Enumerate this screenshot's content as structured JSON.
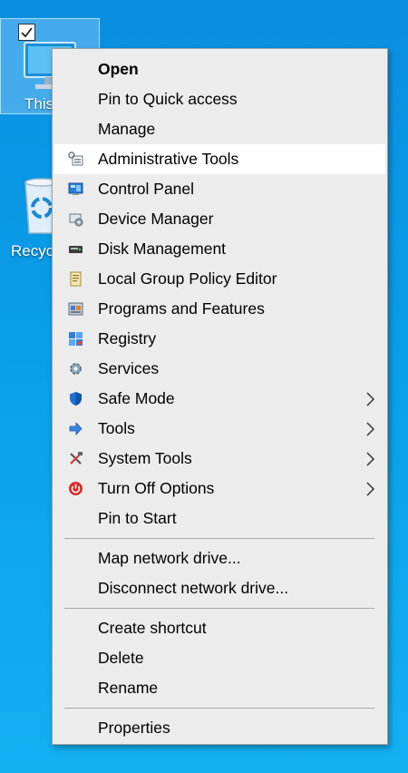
{
  "desktop": {
    "this_pc_label": "This PC",
    "recycle_bin_label": "Recycle Bin",
    "accent_color": "#0a9ee8"
  },
  "menu": {
    "group1": [
      {
        "label": "Open",
        "bold": true
      },
      {
        "label": "Pin to Quick access"
      },
      {
        "label": "Manage"
      },
      {
        "label": "Administrative Tools",
        "icon": "admin-tools-icon",
        "hover": true
      },
      {
        "label": "Control Panel",
        "icon": "control-panel-icon"
      },
      {
        "label": "Device Manager",
        "icon": "device-manager-icon"
      },
      {
        "label": "Disk Management",
        "icon": "disk-management-icon"
      },
      {
        "label": "Local Group Policy Editor",
        "icon": "group-policy-icon"
      },
      {
        "label": "Programs and Features",
        "icon": "programs-features-icon"
      },
      {
        "label": "Registry",
        "icon": "registry-icon"
      },
      {
        "label": "Services",
        "icon": "services-icon"
      },
      {
        "label": "Safe Mode",
        "icon": "shield-icon",
        "submenu": true
      },
      {
        "label": "Tools",
        "icon": "arrow-icon",
        "submenu": true
      },
      {
        "label": "System Tools",
        "icon": "tools-icon",
        "submenu": true
      },
      {
        "label": "Turn Off Options",
        "icon": "power-icon",
        "submenu": true
      },
      {
        "label": "Pin to Start"
      }
    ],
    "group2": [
      {
        "label": "Map network drive..."
      },
      {
        "label": "Disconnect network drive..."
      }
    ],
    "group3": [
      {
        "label": "Create shortcut"
      },
      {
        "label": "Delete"
      },
      {
        "label": "Rename"
      }
    ],
    "group4": [
      {
        "label": "Properties"
      }
    ]
  }
}
